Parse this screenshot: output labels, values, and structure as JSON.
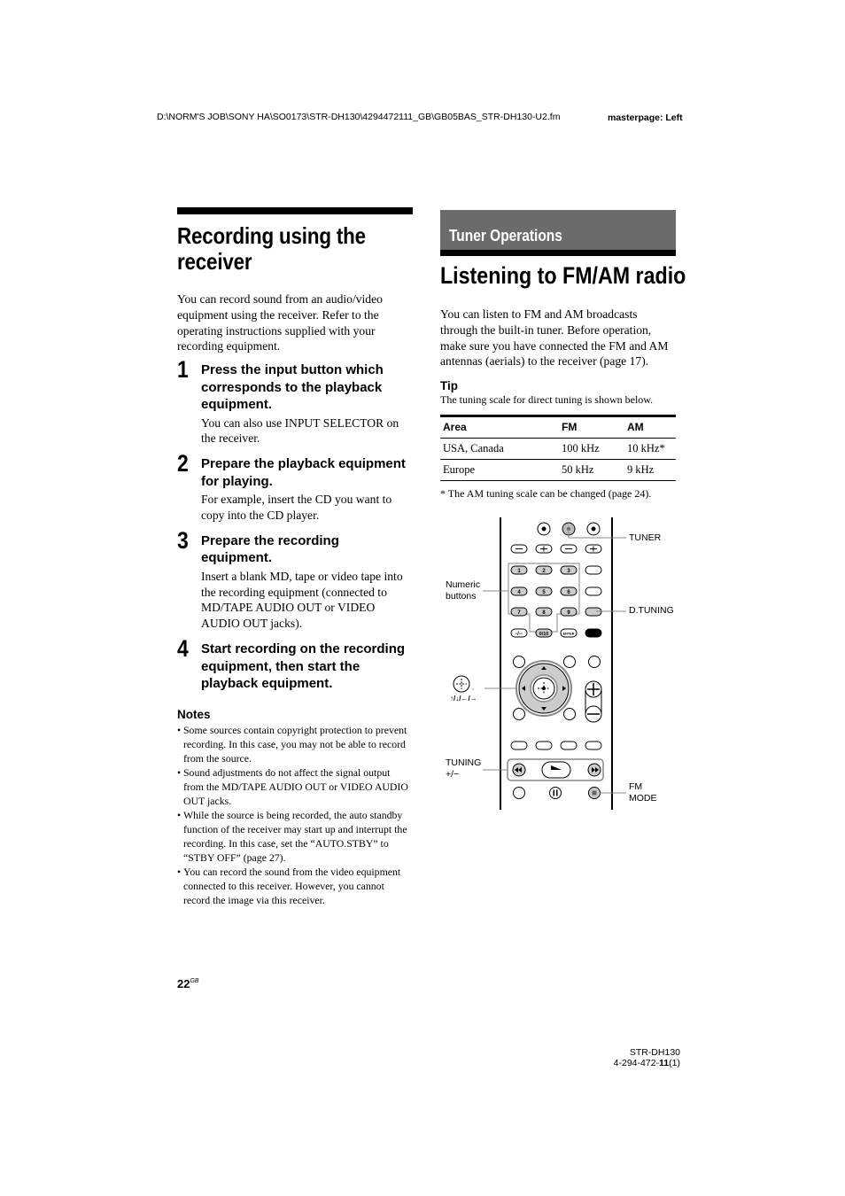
{
  "header": {
    "file_path": "D:\\NORM'S JOB\\SONY HA\\SO0173\\STR-DH130\\4294472111_GB\\GB05BAS_STR-DH130-U2.fm",
    "masterpage": "masterpage: Left"
  },
  "left": {
    "title": "Recording using the receiver",
    "intro": "You can record sound from an audio/video equipment using the receiver. Refer to the operating instructions supplied with your recording equipment.",
    "steps": [
      {
        "num": "1",
        "title": "Press the input button which corresponds to the playback equipment.",
        "desc": "You can also use INPUT SELECTOR on the receiver."
      },
      {
        "num": "2",
        "title": "Prepare the playback equipment for playing.",
        "desc": "For example, insert the CD you want to copy into the CD player."
      },
      {
        "num": "3",
        "title": "Prepare the recording equipment.",
        "desc": "Insert a blank MD, tape or video tape into the recording equipment (connected to MD/TAPE AUDIO OUT or VIDEO AUDIO OUT jacks)."
      },
      {
        "num": "4",
        "title": "Start recording on the recording equipment, then start the playback equipment.",
        "desc": ""
      }
    ],
    "notes_heading": "Notes",
    "notes": [
      "Some sources contain copyright protection to prevent recording. In this case, you may not be able to record from the source.",
      "Sound adjustments do not affect the signal output from the MD/TAPE AUDIO OUT or VIDEO AUDIO OUT jacks.",
      "While the source is being recorded, the auto standby function of the receiver may start up and interrupt the recording. In this case, set the “AUTO.STBY” to “STBY OFF” (page 27).",
      "You can record the sound from the video equipment connected to this receiver. However, you cannot record the image via this receiver."
    ]
  },
  "right": {
    "section": "Tuner Operations",
    "title": "Listening to FM/AM radio",
    "intro": "You can listen to FM and AM broadcasts through the built-in tuner. Before operation, make sure you have connected the FM and AM antennas (aerials) to the receiver (page 17).",
    "tip_heading": "Tip",
    "tip_text": "The tuning scale for direct tuning is shown below.",
    "table": {
      "headers": [
        "Area",
        "FM",
        "AM"
      ],
      "rows": [
        [
          "USA, Canada",
          "100 kHz",
          "10 kHz*"
        ],
        [
          "Europe",
          "50 kHz",
          "9 kHz"
        ]
      ]
    },
    "footnote": "* The AM tuning scale can be changed (page 24).",
    "remote_labels": {
      "tuner": "TUNER",
      "numeric_1": "Numeric",
      "numeric_2": "buttons",
      "dtuning": "D.TUNING",
      "arrows": "↑/↓/←/→",
      "tuning_1": "TUNING",
      "tuning_2": "+/−",
      "fmmode_1": "FM",
      "fmmode_2": "MODE",
      "keys": [
        "1",
        "2",
        "3",
        "4",
        "5",
        "6",
        "7",
        "8",
        "9",
        "-/--",
        "0/10",
        "ENTER"
      ]
    }
  },
  "footer": {
    "page_number": "22",
    "page_suffix": "GB",
    "model": "STR-DH130",
    "part_prefix": "4-294-472-",
    "part_bold": "11",
    "part_suffix": "(1)"
  }
}
